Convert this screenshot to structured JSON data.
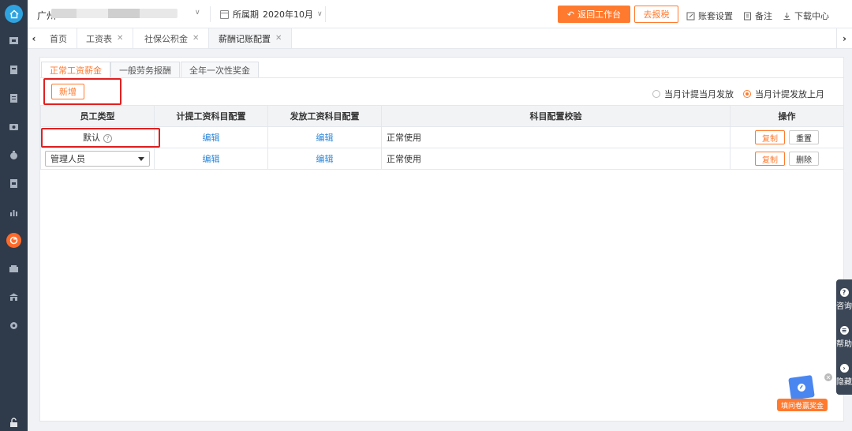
{
  "topbar": {
    "company": "广州",
    "period_label": "所属期",
    "period_value": "2020年10月",
    "return_button": "返回工作台",
    "tax_button": "去报税",
    "account_settings": "账套设置",
    "notes": "备注",
    "download_center": "下载中心"
  },
  "page_tabs": [
    {
      "label": "首页"
    },
    {
      "label": "工资表"
    },
    {
      "label": "社保公积金"
    },
    {
      "label": "薪酬记账配置"
    }
  ],
  "sub_tabs": [
    {
      "label": "正常工资薪金"
    },
    {
      "label": "一般劳务报酬"
    },
    {
      "label": "全年一次性奖金"
    }
  ],
  "add_button": "新增",
  "radio_options": [
    {
      "label": "当月计提当月发放",
      "selected": false
    },
    {
      "label": "当月计提发放上月",
      "selected": true
    }
  ],
  "table": {
    "headers": [
      "员工类型",
      "计提工资科目配置",
      "发放工资科目配置",
      "科目配置校验",
      "操作"
    ],
    "rows": [
      {
        "type": "默认",
        "accrual": "编辑",
        "payment": "编辑",
        "check": "正常使用",
        "op1": "复制",
        "op2": "重置"
      },
      {
        "type": "管理人员",
        "accrual": "编辑",
        "payment": "编辑",
        "check": "正常使用",
        "op1": "复制",
        "op2": "删除"
      }
    ]
  },
  "float_menu": {
    "consult": "咨询",
    "help": "帮助",
    "hide": "隐藏"
  },
  "survey_label": "填问卷赢奖金",
  "colors": {
    "accent": "#ff7a2e",
    "link": "#2e88d8",
    "sidebar": "#2f3a4b",
    "highlight_box": "#e02020"
  }
}
